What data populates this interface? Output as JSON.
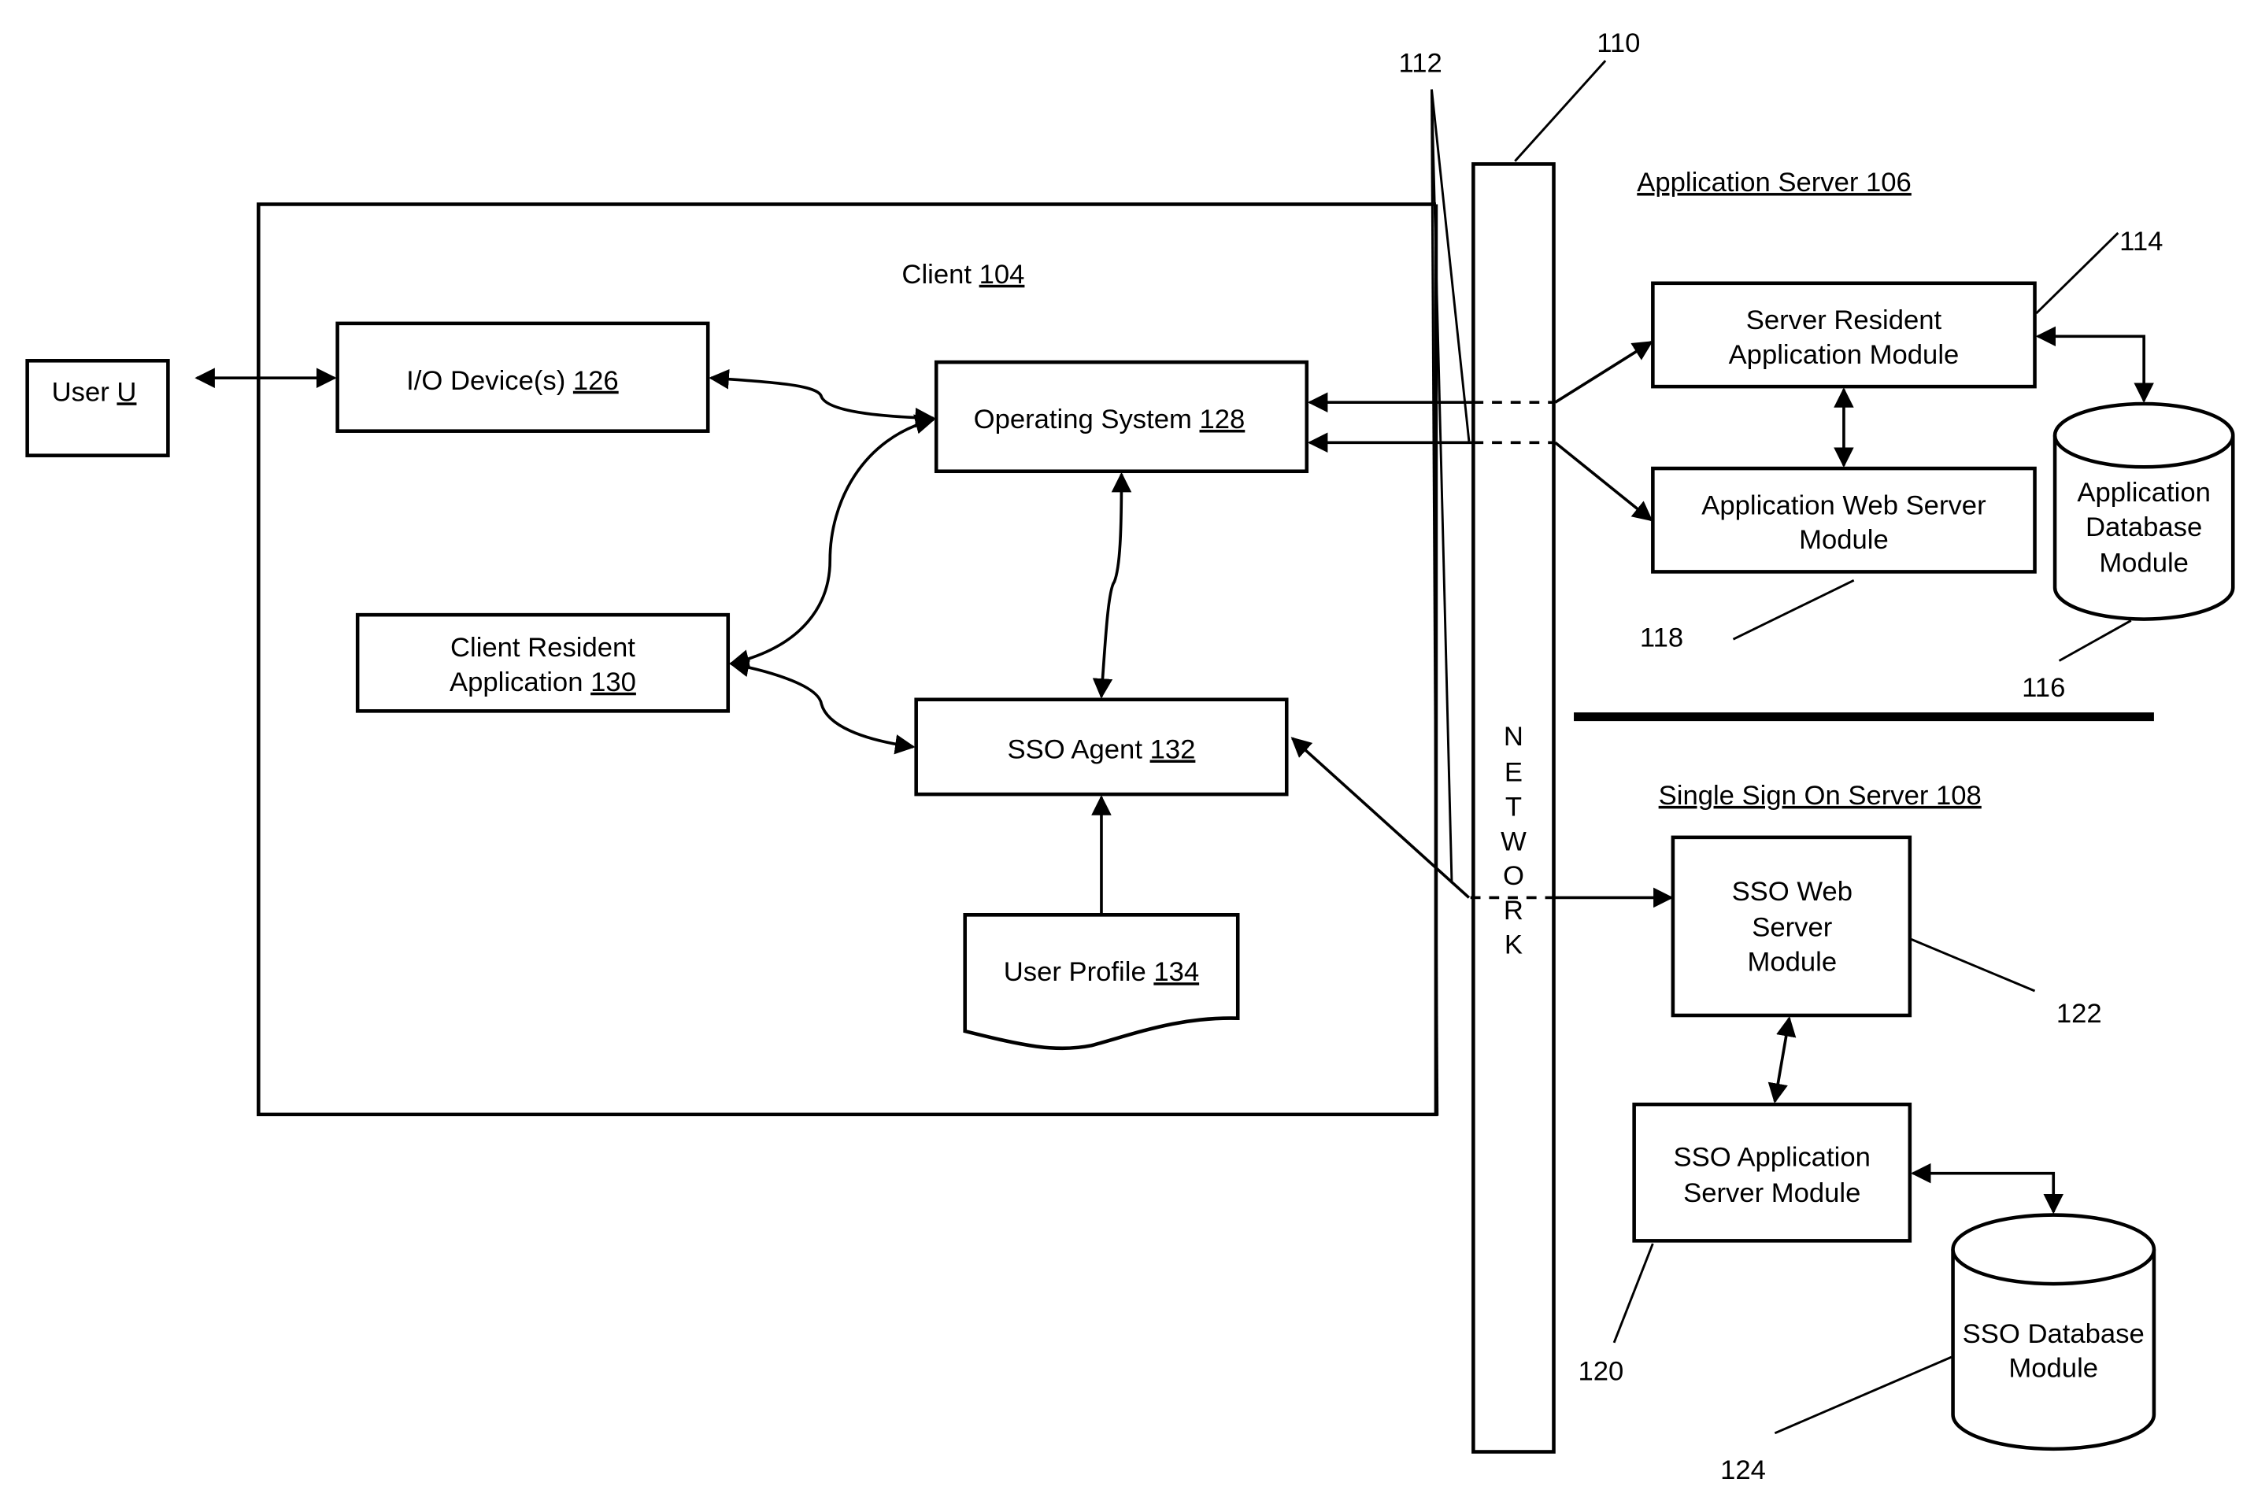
{
  "diagram": {
    "user": {
      "label": "User",
      "ref": "U"
    },
    "client": {
      "label": "Client",
      "ref": "104"
    },
    "io_device": {
      "label": "I/O Device(s)",
      "ref": "126"
    },
    "operating_system": {
      "label": "Operating System",
      "ref": "128"
    },
    "client_resident_app": {
      "line1": "Client Resident",
      "line2": "Application",
      "ref": "130"
    },
    "sso_agent": {
      "label": "SSO Agent",
      "ref": "132"
    },
    "user_profile": {
      "label": "User Profile",
      "ref": "134"
    },
    "network": {
      "letters": [
        "N",
        "E",
        "T",
        "W",
        "O",
        "R",
        "K"
      ],
      "ref": "110"
    },
    "connections_ref": "112",
    "application_server": {
      "title": "Application Server 106",
      "server_resident_module": {
        "line1": "Server Resident",
        "line2": "Application Module",
        "ref": "114"
      },
      "app_web_server_module": {
        "line1": "Application Web Server",
        "line2": "Module",
        "ref": "118"
      },
      "app_database_module": {
        "line1": "Application",
        "line2": "Database",
        "line3": "Module",
        "ref": "116"
      }
    },
    "sso_server": {
      "title": "Single Sign On Server 108",
      "sso_web_server_module": {
        "line1": "SSO Web",
        "line2": "Server",
        "line3": "Module",
        "ref": "122"
      },
      "sso_app_server_module": {
        "line1": "SSO Application",
        "line2": "Server Module",
        "ref": "120"
      },
      "sso_database_module": {
        "line1": "SSO Database",
        "line2": "Module",
        "ref": "124"
      }
    }
  }
}
